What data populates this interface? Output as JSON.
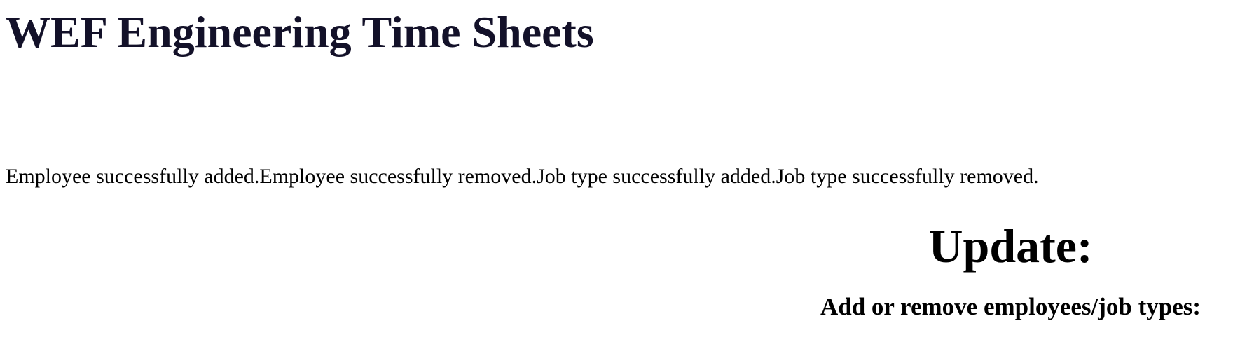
{
  "header": {
    "title": "WEF Engineering Time Sheets"
  },
  "status": {
    "messages": [
      "Employee successfully added.",
      "Employee successfully removed.",
      "Job type successfully added.",
      "Job type successfully removed."
    ]
  },
  "update_section": {
    "heading": "Update:",
    "subheading": "Add or remove employees/job types:"
  },
  "colors": {
    "title_text": "#131129",
    "body_text": "#000000",
    "background": "#ffffff"
  }
}
